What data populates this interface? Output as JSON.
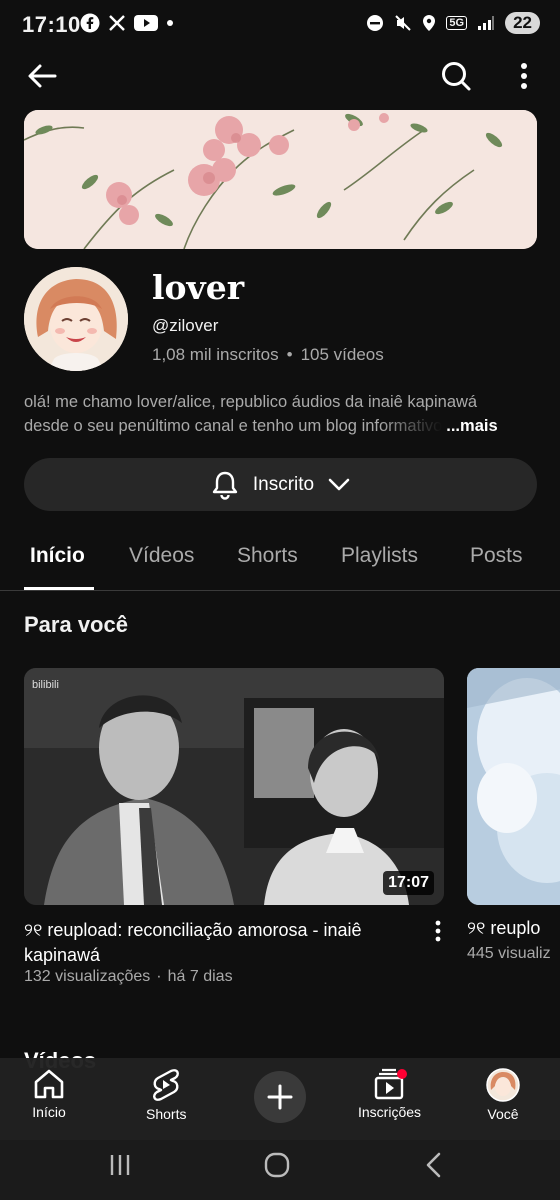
{
  "status": {
    "time": "17:10",
    "battery": "22",
    "network": "5G"
  },
  "channel": {
    "name": "lover",
    "handle": "@zilover",
    "subscribers": "1,08 mil inscritos",
    "separator": "•",
    "videos": "105 vídeos",
    "description_line1": "olá! me chamo lover/alice, republico áudios da inaiê kapinawá",
    "description_line2": "desde o seu penúltimo canal e tenho um blog informativo",
    "more_label": "...mais",
    "subscribed_label": "Inscrito"
  },
  "tabs": [
    {
      "label": "Início",
      "active": true
    },
    {
      "label": "Vídeos",
      "active": false
    },
    {
      "label": "Shorts",
      "active": false
    },
    {
      "label": "Playlists",
      "active": false
    },
    {
      "label": "Posts",
      "active": false
    }
  ],
  "section": {
    "title": "Para você"
  },
  "videos": [
    {
      "title": "୨୧ reupload: reconciliação amorosa - inaiê kapinawá",
      "views": "132 visualizações",
      "separator": "·",
      "age": "há 7 dias",
      "duration": "17:07",
      "watermark": "bilibili"
    },
    {
      "title": "୨୧ reuplo",
      "views": "445 visualiz"
    }
  ],
  "partial_section_title": "Vídeos",
  "bottom_nav": [
    {
      "label": "Início",
      "icon": "home-icon"
    },
    {
      "label": "Shorts",
      "icon": "shorts-icon"
    },
    {
      "label": "",
      "icon": "plus-icon"
    },
    {
      "label": "Inscrições",
      "icon": "subscriptions-icon"
    },
    {
      "label": "Você",
      "icon": "avatar"
    }
  ],
  "colors": {
    "background": "#0f0f0f",
    "secondary_text": "#aaaaaa",
    "button_bg": "#272727",
    "notification_dot": "#ff0033"
  }
}
